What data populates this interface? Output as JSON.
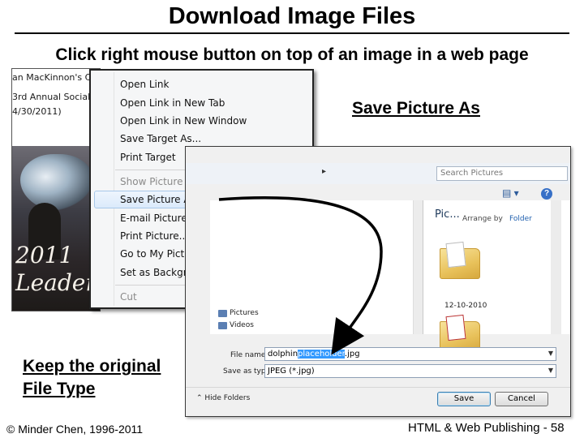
{
  "slide": {
    "title": "Download Image Files",
    "subtitle": "Click right mouse button on top of an image in a web page",
    "callout_save": "Save Picture As",
    "callout_keep_line1": "Keep the original",
    "callout_keep_line2": "File Type",
    "footer_left": "© Minder Chen, 1996-2011",
    "footer_right": "HTML & Web Publishing - 58"
  },
  "webpage": {
    "line1": "an MacKinnon's C",
    "line2": "3rd Annual Social",
    "line3": "4/30/2011)",
    "image_text1": "2011",
    "image_text2": "Leader"
  },
  "context_menu": {
    "items": [
      {
        "label": "Open Link"
      },
      {
        "label": "Open Link in New Tab"
      },
      {
        "label": "Open Link in New Window"
      },
      {
        "label": "Save Target As..."
      },
      {
        "label": "Print Target"
      },
      {
        "label": "Show Picture",
        "disabled": true
      },
      {
        "label": "Save Picture As...",
        "highlighted": true
      },
      {
        "label": "E-mail Picture..."
      },
      {
        "label": "Print Picture..."
      },
      {
        "label": "Go to My Pictures"
      },
      {
        "label": "Set as Background"
      },
      {
        "label": "Cut",
        "disabled": true
      }
    ]
  },
  "save_dialog": {
    "search_placeholder": "Search Pictures",
    "library_title": "Pic...",
    "arrange_label": "Arrange by",
    "arrange_value": "Folder",
    "folder_date": "12-10-2010",
    "nav_items": [
      "Pictures",
      "Videos"
    ],
    "file_name_label": "File name:",
    "file_name_prefix": "dolphin",
    "file_name_selected": "placeholder",
    "file_name_suffix": ".jpg",
    "save_as_type_label": "Save as type:",
    "save_as_type_value": "JPEG (*.jpg)",
    "hide_folders": "Hide Folders",
    "save_button": "Save",
    "cancel_button": "Cancel"
  },
  "colors": {
    "highlight_border": "#a8c8ea",
    "selection": "#3399ff",
    "arrow": "#000000"
  },
  "icons": [
    "back-forward-arrows-icon",
    "refresh-icon",
    "views-icon",
    "help-icon",
    "folder-icon",
    "pictures-library-icon",
    "videos-library-icon",
    "chevron-down-icon"
  ]
}
